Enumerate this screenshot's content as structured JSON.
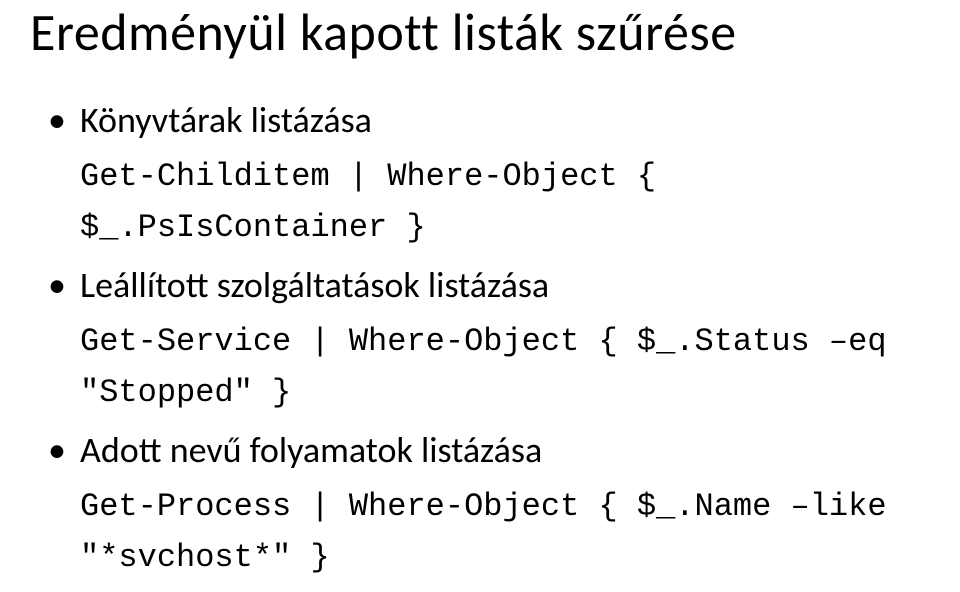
{
  "title": "Eredményül kapott listák szűrése",
  "sections": [
    {
      "bullet": "Könyvtárak listázása",
      "code": "Get-Childitem | Where-Object { $_.PsIsContainer }"
    },
    {
      "bullet": "Leállított szolgáltatások listázása",
      "code": "Get-Service | Where-Object { $_.Status –eq \"Stopped\" }"
    },
    {
      "bullet": "Adott nevű folyamatok listázása",
      "code": "Get-Process | Where-Object { $_.Name –like \"*svchost*\" }"
    }
  ]
}
